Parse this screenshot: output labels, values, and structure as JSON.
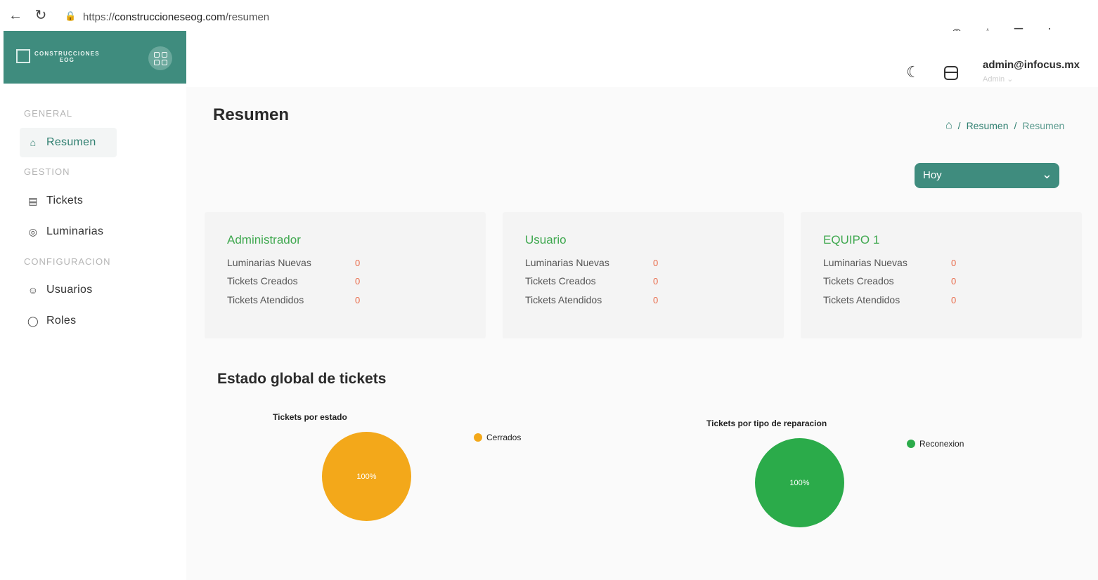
{
  "browser": {
    "url_prefix": "https://",
    "url_host": "construccioneseog.com",
    "url_path": "/resumen"
  },
  "brand": {
    "line1": "CONSTRUCCIONES",
    "line2": "EOG"
  },
  "sidebar": {
    "sections": [
      {
        "title": "GENERAL",
        "items": [
          {
            "label": "Resumen",
            "icon": "home-icon",
            "active": true
          }
        ]
      },
      {
        "title": "GESTION",
        "items": [
          {
            "label": "Tickets",
            "icon": "ticket-icon"
          },
          {
            "label": "Luminarias",
            "icon": "lightbulb-icon"
          }
        ]
      },
      {
        "title": "CONFIGURACION",
        "items": [
          {
            "label": "Usuarios",
            "icon": "user-icon"
          },
          {
            "label": "Roles",
            "icon": "shield-icon"
          }
        ]
      }
    ]
  },
  "header": {
    "user_email": "admin@infocus.mx",
    "user_role": "Admin"
  },
  "page": {
    "title": "Resumen",
    "breadcrumb": [
      "Resumen",
      "Resumen"
    ],
    "period_select": "Hoy"
  },
  "cards": [
    {
      "name": "Administrador",
      "rows": [
        {
          "label": "Luminarias Nuevas",
          "value": "0"
        },
        {
          "label": "Tickets Creados",
          "value": "0"
        },
        {
          "label": "Tickets Atendidos",
          "value": "0"
        }
      ]
    },
    {
      "name": "Usuario",
      "rows": [
        {
          "label": "Luminarias Nuevas",
          "value": "0"
        },
        {
          "label": "Tickets Creados",
          "value": "0"
        },
        {
          "label": "Tickets Atendidos",
          "value": "0"
        }
      ]
    },
    {
      "name": "EQUIPO 1",
      "rows": [
        {
          "label": "Luminarias Nuevas",
          "value": "0"
        },
        {
          "label": "Tickets Creados",
          "value": "0"
        },
        {
          "label": "Tickets Atendidos",
          "value": "0"
        }
      ]
    }
  ],
  "section": {
    "title": "Estado global de tickets"
  },
  "chart_data": [
    {
      "type": "pie",
      "title": "Tickets por estado",
      "categories": [
        "Cerrados"
      ],
      "values": [
        100
      ],
      "labels": [
        "100%"
      ],
      "colors": [
        "#f3a81a"
      ],
      "legend": "top-right"
    },
    {
      "type": "pie",
      "title": "Tickets por tipo de reparacion",
      "categories": [
        "Reconexion"
      ],
      "values": [
        100
      ],
      "labels": [
        "100%"
      ],
      "colors": [
        "#2bab4a"
      ],
      "legend": "top-right"
    }
  ]
}
